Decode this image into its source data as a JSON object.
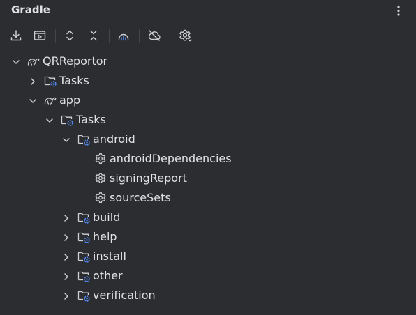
{
  "panel": {
    "title": "Gradle",
    "more_icon": "more-vertical-icon"
  },
  "toolbar": {
    "buttons": [
      {
        "name": "download-sources-icon"
      },
      {
        "name": "run-task-icon"
      },
      {
        "name": "expand-all-icon"
      },
      {
        "name": "collapse-all-icon"
      },
      {
        "name": "analyze-dependencies-icon"
      },
      {
        "name": "offline-mode-icon"
      },
      {
        "name": "gradle-settings-icon"
      }
    ]
  },
  "tree": {
    "items": [
      {
        "label": "QRReportor",
        "icon": "gradle-elephant-icon",
        "state": "expanded"
      },
      {
        "label": "Tasks",
        "icon": "task-folder-icon",
        "state": "collapsed"
      },
      {
        "label": "app",
        "icon": "gradle-elephant-icon",
        "state": "expanded"
      },
      {
        "label": "Tasks",
        "icon": "task-folder-icon",
        "state": "expanded"
      },
      {
        "label": "android",
        "icon": "task-folder-icon",
        "state": "expanded"
      },
      {
        "label": "androidDependencies",
        "icon": "task-gear-icon",
        "state": "leaf"
      },
      {
        "label": "signingReport",
        "icon": "task-gear-icon",
        "state": "leaf"
      },
      {
        "label": "sourceSets",
        "icon": "task-gear-icon",
        "state": "leaf"
      },
      {
        "label": "build",
        "icon": "task-folder-icon",
        "state": "collapsed"
      },
      {
        "label": "help",
        "icon": "task-folder-icon",
        "state": "collapsed"
      },
      {
        "label": "install",
        "icon": "task-folder-icon",
        "state": "collapsed"
      },
      {
        "label": "other",
        "icon": "task-folder-icon",
        "state": "collapsed"
      },
      {
        "label": "verification",
        "icon": "task-folder-icon",
        "state": "collapsed"
      }
    ]
  },
  "colors": {
    "background": "#2b2d30",
    "text": "#dfe1e5",
    "icon": "#ced0d6",
    "accent": "#548af7"
  }
}
